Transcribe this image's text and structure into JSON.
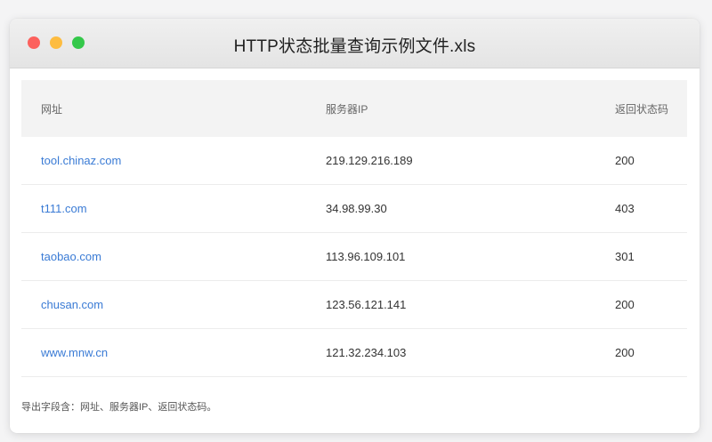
{
  "window": {
    "title": "HTTP状态批量查询示例文件.xls",
    "traffic_lights": {
      "close_color": "#fc615d",
      "minimize_color": "#fdbc40",
      "zoom_color": "#34c84a"
    }
  },
  "table": {
    "headers": [
      "网址",
      "服务器IP",
      "返回状态码"
    ],
    "rows": [
      {
        "url": "tool.chinaz.com",
        "ip": "219.129.216.189",
        "status": "200"
      },
      {
        "url": "t111.com",
        "ip": "34.98.99.30",
        "status": "403"
      },
      {
        "url": "taobao.com",
        "ip": "113.96.109.101",
        "status": "301"
      },
      {
        "url": "chusan.com",
        "ip": "123.56.121.141",
        "status": "200"
      },
      {
        "url": "www.mnw.cn",
        "ip": "121.32.234.103",
        "status": "200"
      }
    ]
  },
  "footer": {
    "note": "导出字段含：网址、服务器IP、返回状态码。"
  },
  "colors": {
    "link": "#3a7bd5",
    "header_bg": "#f3f3f3"
  }
}
